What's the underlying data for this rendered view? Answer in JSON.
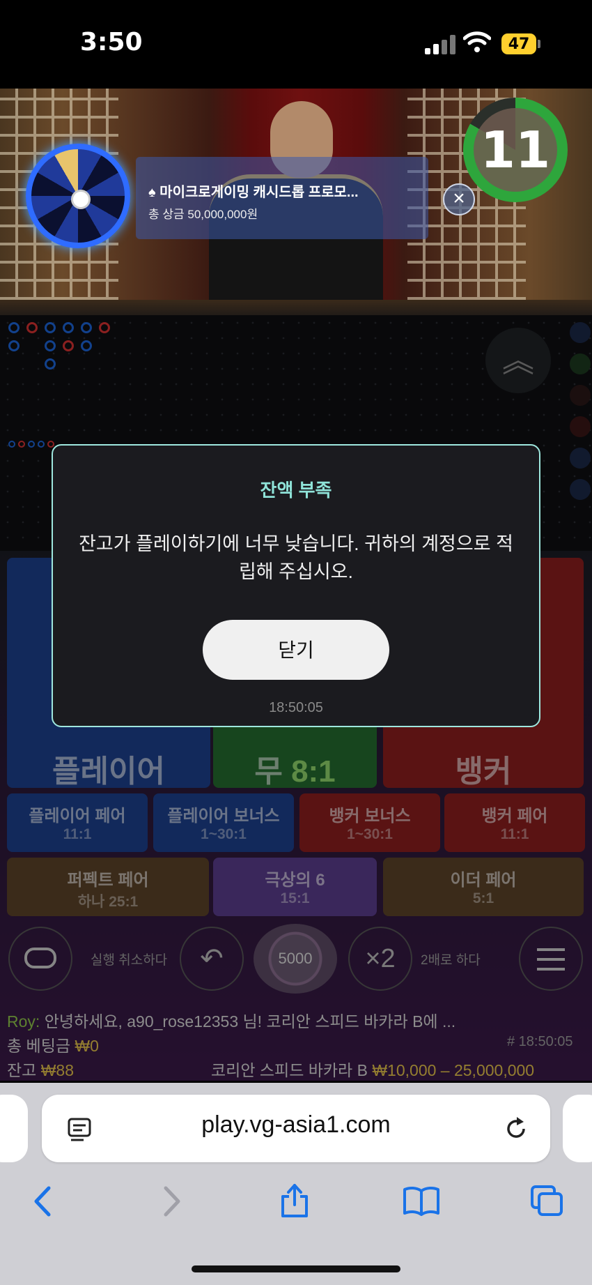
{
  "status_bar": {
    "time": "3:50",
    "battery": "47"
  },
  "video": {
    "promo_title": "♠ 마이크로게이밍 캐시드롭 프로모...",
    "promo_prize": "총 상금 50,000,000원",
    "timer": "11"
  },
  "modal": {
    "title": "잔액 부족",
    "message": "잔고가 플레이하기에 너무 낮습니다. 귀하의 계정으로 적립해 주십시오.",
    "close_label": "닫기",
    "timestamp": "18:50:05"
  },
  "bets": {
    "main": [
      {
        "name": "플레이어",
        "odds": ""
      },
      {
        "name": "무",
        "odds": "8:1"
      },
      {
        "name": "뱅커",
        "odds": ""
      }
    ],
    "side_row1": [
      {
        "name": "플레이어 페어",
        "odds": "11:1"
      },
      {
        "name": "플레이어 보너스",
        "odds": "1~30:1"
      },
      {
        "name": "뱅커 보너스",
        "odds": "1~30:1"
      },
      {
        "name": "뱅커 페어",
        "odds": "11:1"
      }
    ],
    "side_row2": [
      {
        "name": "퍼펙트 페어",
        "odds": "하나 25:1"
      },
      {
        "name": "극상의 6",
        "odds": "15:1"
      },
      {
        "name": "이더 페어",
        "odds": "5:1"
      }
    ]
  },
  "controls": {
    "undo_label": "실행 취소하다",
    "chip_value": "5000",
    "double_symbol": "×2",
    "double_label": "2배로 하다"
  },
  "chat": {
    "sender": "Roy:",
    "message": "안녕하세요, a90_rose12353 님! 코리안 스피드 바카라 B에 ..."
  },
  "footer": {
    "total_bet_label": "총 베팅금",
    "total_bet_value": "₩0",
    "round_id": "# 18:50:05",
    "balance_label": "잔고",
    "balance_value": "₩88",
    "table_name": "코리안 스피드 바카라 B",
    "limits": "₩10,000 – 25,000,000"
  },
  "browser": {
    "url": "play.vg-asia1.com"
  },
  "colors": {
    "accent": "#8fe3d8",
    "gold": "#e4c24a",
    "modal_bg": "#1b1b1f"
  }
}
